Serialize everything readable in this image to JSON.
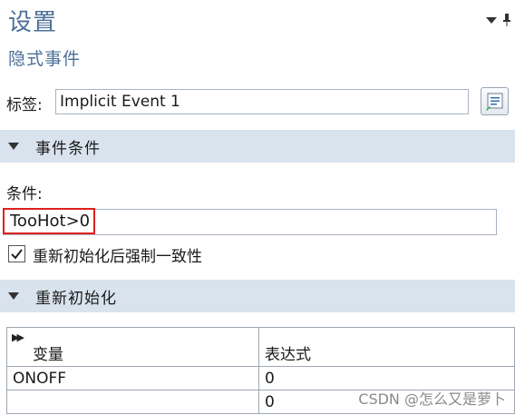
{
  "header": {
    "title": "设置",
    "subtitle": "隐式事件"
  },
  "label_field": {
    "label": "标签:",
    "value": "Implicit Event 1"
  },
  "section_event": {
    "title": "事件条件"
  },
  "condition": {
    "label": "条件:",
    "value": "TooHot>0"
  },
  "reinit_checkbox": {
    "label": "重新初始化后强制一致性",
    "checked": true
  },
  "section_reinit": {
    "title": "重新初始化"
  },
  "reinit_table": {
    "headers": [
      "变量",
      "表达式"
    ],
    "rows": [
      {
        "variable": "ONOFF",
        "expression": "0"
      },
      {
        "variable": "",
        "expression": "0"
      }
    ]
  },
  "watermark": "CSDN @怎么又是萝卜",
  "colors": {
    "accent": "#4d6f97",
    "section_bg": "#d9e3ee",
    "highlight_border": "#e02020"
  }
}
